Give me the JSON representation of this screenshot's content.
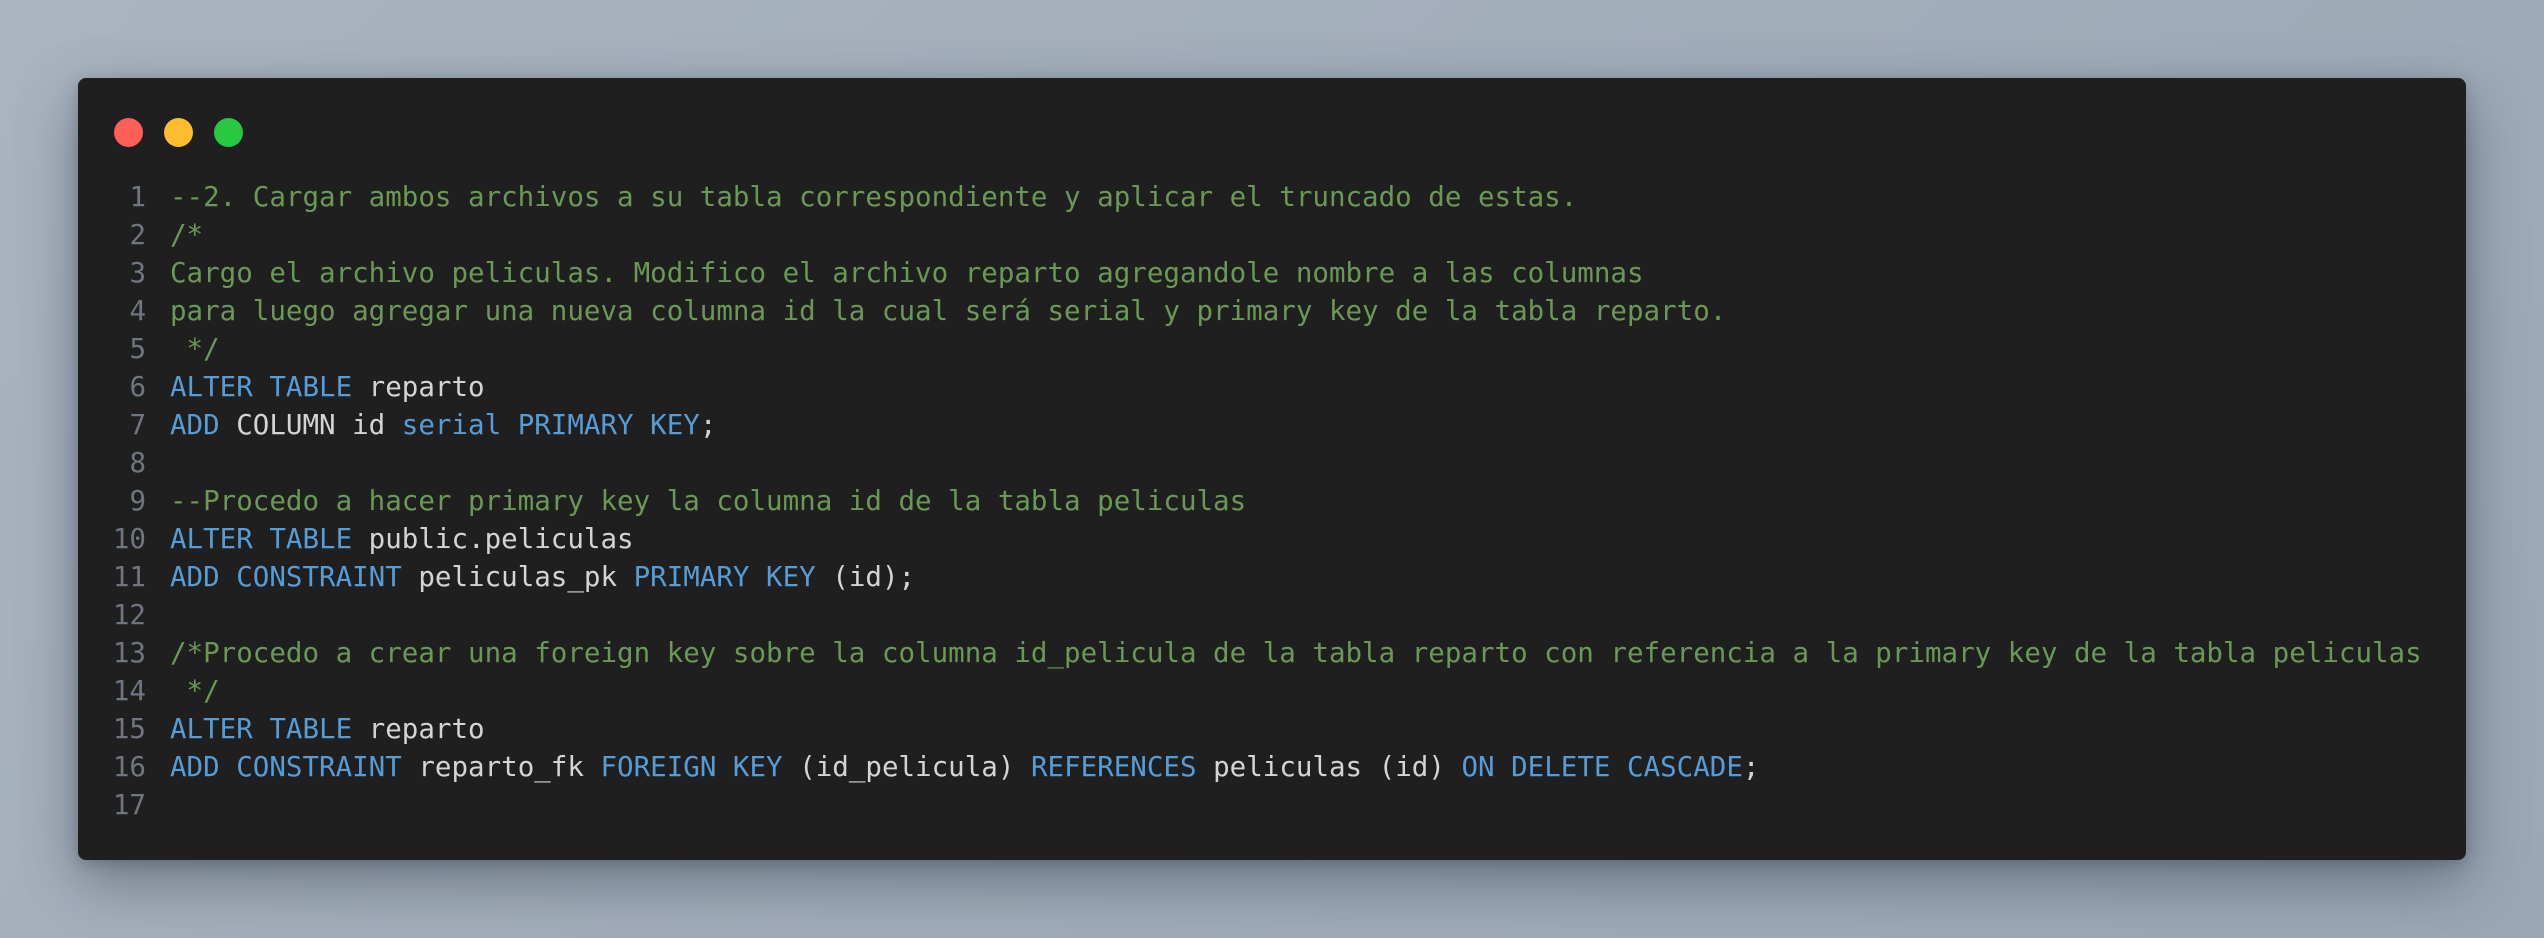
{
  "colors": {
    "window_bg": "#1f1f1f",
    "close": "#ff5f57",
    "minimize": "#febc2e",
    "maximize": "#28c840",
    "comment": "#6a9955",
    "keyword": "#569cd6",
    "plain": "#d4d4d4",
    "line_number": "#6f7680"
  },
  "window_controls": [
    {
      "name": "close-button",
      "color": "#ff5f57"
    },
    {
      "name": "minimize-button",
      "color": "#febc2e"
    },
    {
      "name": "maximize-button",
      "color": "#28c840"
    }
  ],
  "lines": [
    {
      "number": "1",
      "tokens": [
        {
          "t": "c",
          "text": "--2. Cargar ambos archivos a su tabla correspondiente y aplicar el truncado de estas."
        }
      ]
    },
    {
      "number": "2",
      "tokens": [
        {
          "t": "c",
          "text": "/*"
        }
      ]
    },
    {
      "number": "3",
      "tokens": [
        {
          "t": "c",
          "text": "Cargo el archivo peliculas. Modifico el archivo reparto agregandole nombre a las columnas"
        }
      ]
    },
    {
      "number": "4",
      "tokens": [
        {
          "t": "c",
          "text": "para luego agregar una nueva columna id la cual será serial y primary key de la tabla reparto."
        }
      ]
    },
    {
      "number": "5",
      "tokens": [
        {
          "t": "c",
          "text": " */"
        }
      ]
    },
    {
      "number": "6",
      "tokens": [
        {
          "t": "k",
          "text": "ALTER TABLE"
        },
        {
          "t": "p",
          "text": " reparto"
        }
      ]
    },
    {
      "number": "7",
      "tokens": [
        {
          "t": "k",
          "text": "ADD"
        },
        {
          "t": "p",
          "text": " COLUMN id "
        },
        {
          "t": "k",
          "text": "serial PRIMARY KEY"
        },
        {
          "t": "p",
          "text": ";"
        }
      ]
    },
    {
      "number": "8",
      "tokens": []
    },
    {
      "number": "9",
      "tokens": [
        {
          "t": "c",
          "text": "--Procedo a hacer primary key la columna id de la tabla peliculas"
        }
      ]
    },
    {
      "number": "10",
      "tokens": [
        {
          "t": "k",
          "text": "ALTER TABLE"
        },
        {
          "t": "p",
          "text": " public.peliculas"
        }
      ]
    },
    {
      "number": "11",
      "tokens": [
        {
          "t": "k",
          "text": "ADD CONSTRAINT"
        },
        {
          "t": "p",
          "text": " peliculas_pk "
        },
        {
          "t": "k",
          "text": "PRIMARY KEY"
        },
        {
          "t": "p",
          "text": " (id);"
        }
      ]
    },
    {
      "number": "12",
      "tokens": []
    },
    {
      "number": "13",
      "tokens": [
        {
          "t": "c",
          "text": "/*Procedo a crear una foreign key sobre la columna id_pelicula de la tabla reparto con referencia a la primary key de la tabla peliculas"
        }
      ]
    },
    {
      "number": "14",
      "tokens": [
        {
          "t": "c",
          "text": " */"
        }
      ]
    },
    {
      "number": "15",
      "tokens": [
        {
          "t": "k",
          "text": "ALTER TABLE"
        },
        {
          "t": "p",
          "text": " reparto"
        }
      ]
    },
    {
      "number": "16",
      "tokens": [
        {
          "t": "k",
          "text": "ADD CONSTRAINT"
        },
        {
          "t": "p",
          "text": " reparto_fk "
        },
        {
          "t": "k",
          "text": "FOREIGN KEY"
        },
        {
          "t": "p",
          "text": " (id_pelicula) "
        },
        {
          "t": "k",
          "text": "REFERENCES"
        },
        {
          "t": "p",
          "text": " peliculas (id) "
        },
        {
          "t": "k",
          "text": "ON DELETE CASCADE"
        },
        {
          "t": "p",
          "text": ";"
        }
      ]
    },
    {
      "number": "17",
      "tokens": []
    }
  ]
}
